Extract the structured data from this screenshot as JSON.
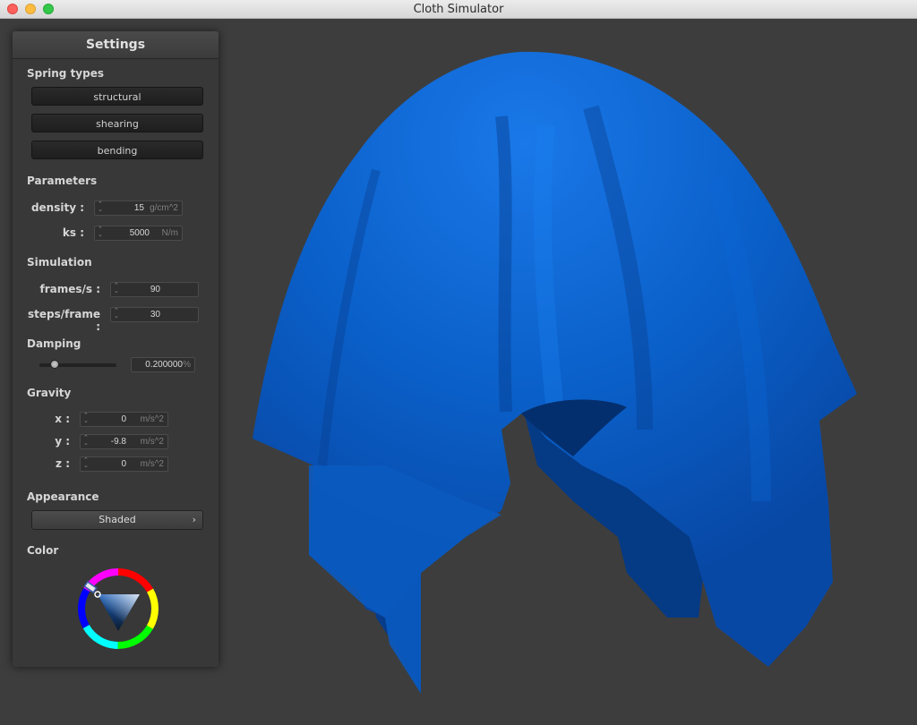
{
  "window": {
    "title": "Cloth Simulator"
  },
  "colors": {
    "cloth": "#0a5fc8",
    "cloth_shadow": "#053a85",
    "panel_bg": "#383838",
    "viewport_bg": "#3d3d3d"
  },
  "settings": {
    "title": "Settings",
    "spring_types": {
      "label": "Spring types",
      "buttons": [
        "structural",
        "shearing",
        "bending"
      ]
    },
    "parameters": {
      "label": "Parameters",
      "density": {
        "label": "density :",
        "value": "15",
        "unit": "g/cm^2"
      },
      "ks": {
        "label": "ks :",
        "value": "5000",
        "unit": "N/m"
      }
    },
    "simulation": {
      "label": "Simulation",
      "fps": {
        "label": "frames/s :",
        "value": "90"
      },
      "steps": {
        "label": "steps/frame :",
        "value": "30"
      }
    },
    "damping": {
      "label": "Damping",
      "value": "0.200000",
      "unit": "%",
      "slider_fraction": 0.2
    },
    "gravity": {
      "label": "Gravity",
      "x": {
        "label": "x :",
        "value": "0",
        "unit": "m/s^2"
      },
      "y": {
        "label": "y :",
        "value": "-9.8",
        "unit": "m/s^2"
      },
      "z": {
        "label": "z :",
        "value": "0",
        "unit": "m/s^2"
      }
    },
    "appearance": {
      "label": "Appearance",
      "selected": "Shaded",
      "arrow": "›"
    },
    "color": {
      "label": "Color",
      "icon": "color-wheel-icon"
    }
  }
}
